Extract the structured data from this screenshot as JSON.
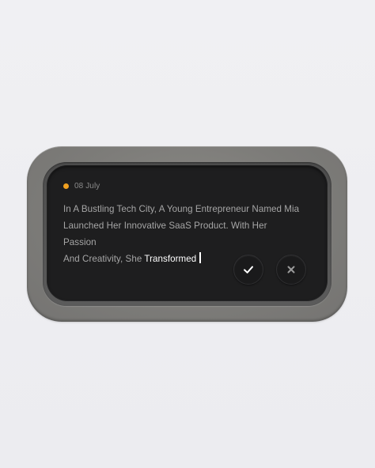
{
  "note": {
    "date": "08 July",
    "text_line1": "In A Bustling Tech City, A Young Entrepreneur Named Mia",
    "text_line2": "Launched Her Innovative SaaS Product. With Her Passion",
    "text_line3_prefix": "And Creativity, She ",
    "text_line3_active": "Transformed"
  },
  "actions": {
    "confirm_icon": "checkmark-icon",
    "cancel_icon": "close-icon"
  },
  "colors": {
    "accent_dot": "#f0a020",
    "screen": "#1e1e1f",
    "bezel": "#7d7c79",
    "text_muted": "#a6a6a6",
    "text_active": "#ffffff"
  }
}
